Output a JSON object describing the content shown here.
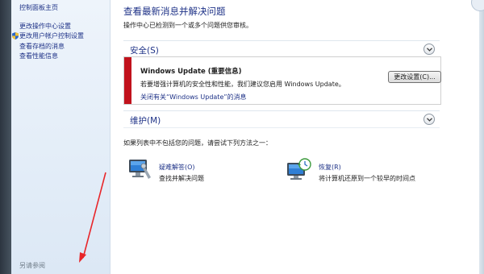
{
  "sidebar": {
    "home": "控制面板主页",
    "links": [
      {
        "label": "更改操作中心设置",
        "icon": ""
      },
      {
        "label": "更改用户帐户控制设置",
        "icon": "uac-shield-icon"
      },
      {
        "label": "查看存档的消息",
        "icon": ""
      },
      {
        "label": "查看性能信息",
        "icon": ""
      }
    ],
    "see_also": "另请参阅"
  },
  "main": {
    "title": "查看最新消息并解决问题",
    "subtitle": "操作中心已检测到一个或多个问题供您审核。",
    "security": {
      "label": "安全(S)",
      "alert": {
        "title": "Windows Update (重要信息)",
        "description": "若要增强计算机的安全性和性能，我们建议您启用 Windows Update。",
        "link": "关闭有关“Windows Update”的消息",
        "button": "更改设置(C)...",
        "accent": "#c1121c"
      }
    },
    "maintenance": {
      "label": "维护(M)"
    },
    "hint": "如果列表中不包括您的问题，请尝试下列方法之一：",
    "tools": [
      {
        "name": "疑难解答(O)",
        "description": "查找并解决问题",
        "icon": "troubleshoot-icon"
      },
      {
        "name": "恢复(R)",
        "description": "将计算机还原到一个较早的时间点",
        "icon": "recovery-icon"
      }
    ]
  },
  "colors": {
    "link": "#1e3287",
    "annotation_arrow": "#e8262a"
  }
}
